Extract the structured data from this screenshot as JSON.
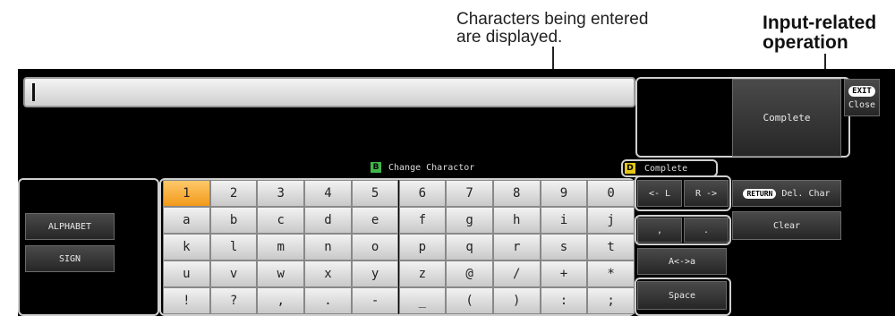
{
  "annotations": {
    "display_line1": "Characters being entered",
    "display_line2": "are displayed.",
    "operation_line1": "Input-related",
    "operation_line2": "operation"
  },
  "top_bar": {
    "exit_badge": "EXIT",
    "close_label": "Close",
    "complete_label": "Complete"
  },
  "legend": {
    "b_key": "B",
    "b_label": "Change Charactor",
    "d_key": "D",
    "d_label": "Complete"
  },
  "modes": {
    "alphabet": "ALPHABET",
    "sign": "SIGN"
  },
  "keyboard": {
    "rows": [
      [
        "1",
        "2",
        "3",
        "4",
        "5",
        "6",
        "7",
        "8",
        "9",
        "0"
      ],
      [
        "a",
        "b",
        "c",
        "d",
        "e",
        "f",
        "g",
        "h",
        "i",
        "j"
      ],
      [
        "k",
        "l",
        "m",
        "n",
        "o",
        "p",
        "q",
        "r",
        "s",
        "t"
      ],
      [
        "u",
        "v",
        "w",
        "x",
        "y",
        "z",
        "@",
        "/",
        "+",
        "*"
      ],
      [
        "!",
        "?",
        ",",
        ".",
        "-",
        "_",
        "(",
        ")",
        ":",
        ";"
      ]
    ],
    "active_key": "1"
  },
  "operations": {
    "cursor_left": "<- L",
    "cursor_right": "R ->",
    "return_badge": "RETURN",
    "del_char": "Del. Char",
    "comma": ",",
    "period": ".",
    "clear": "Clear",
    "case_toggle": "A<->a",
    "space": "Space"
  },
  "colors": {
    "active_key": "#f29a1a",
    "badge_b": "#3fb54a",
    "badge_d": "#e6c619"
  }
}
